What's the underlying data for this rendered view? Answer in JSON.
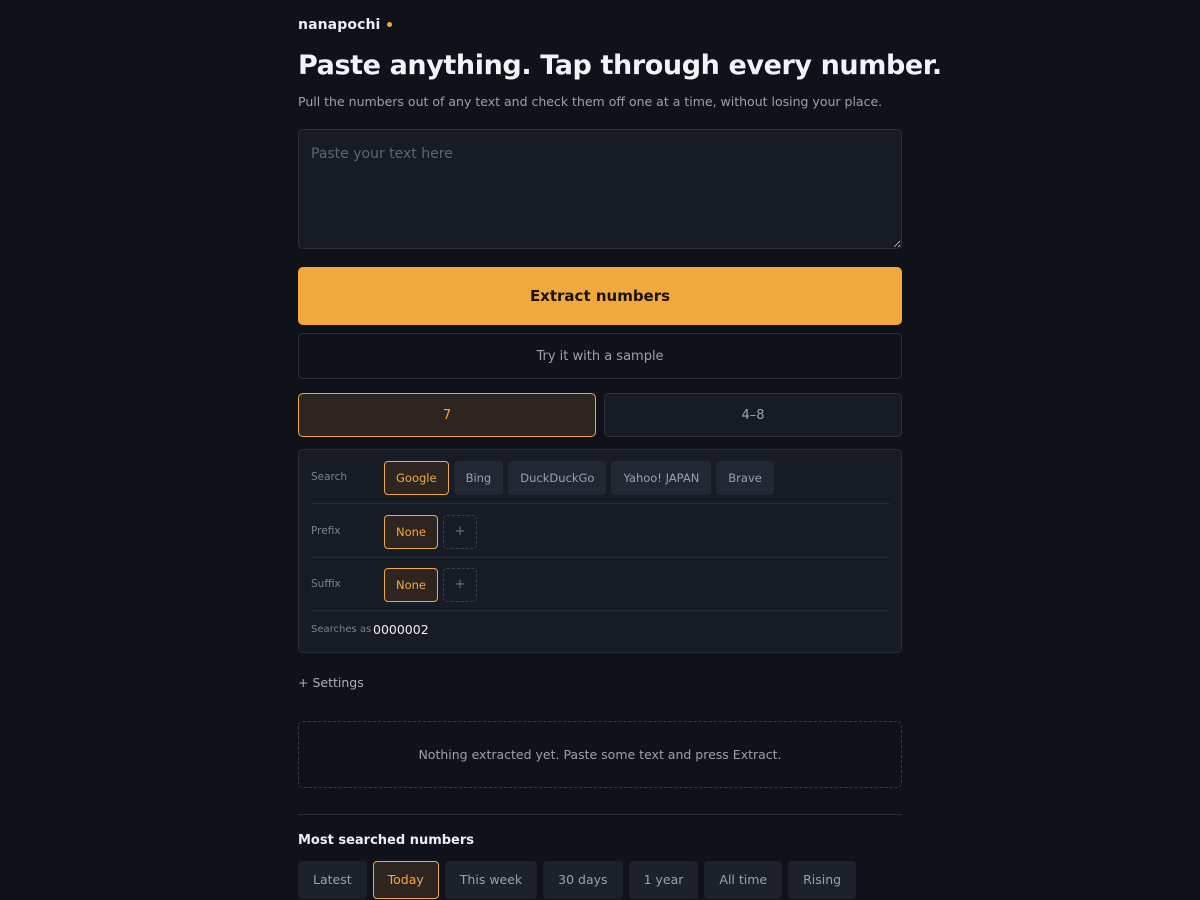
{
  "brand": {
    "name": "nanapochi"
  },
  "hero": {
    "title": "Paste anything. Tap through every number.",
    "subtitle": "Pull the numbers out of any text and check them off one at a time, without losing your place."
  },
  "input": {
    "placeholder": "Paste your text here",
    "value": ""
  },
  "actions": {
    "extract_label": "Extract numbers",
    "sample_label": "Try it with a sample"
  },
  "modes": {
    "selected": "7",
    "other": "4–8"
  },
  "options": {
    "search": {
      "label": "Search",
      "engines": [
        "Google",
        "Bing",
        "DuckDuckGo",
        "Yahoo! JAPAN",
        "Brave"
      ],
      "selected": "Google"
    },
    "prefix": {
      "label": "Prefix",
      "selected": "None",
      "add": "+"
    },
    "suffix": {
      "label": "Suffix",
      "selected": "None",
      "add": "+"
    },
    "searches_as": {
      "label": "Searches as",
      "value": "0000002"
    }
  },
  "settings": {
    "label": "+ Settings"
  },
  "results": {
    "empty_text": "Nothing extracted yet. Paste some text and press Extract."
  },
  "most_searched": {
    "title": "Most searched numbers",
    "tabs": [
      "Latest",
      "Today",
      "This week",
      "30 days",
      "1 year",
      "All time",
      "Rising"
    ],
    "selected": "Today"
  },
  "colors": {
    "background": "#0f1219",
    "accent": "#f0a93f",
    "panel": "#161b24"
  }
}
